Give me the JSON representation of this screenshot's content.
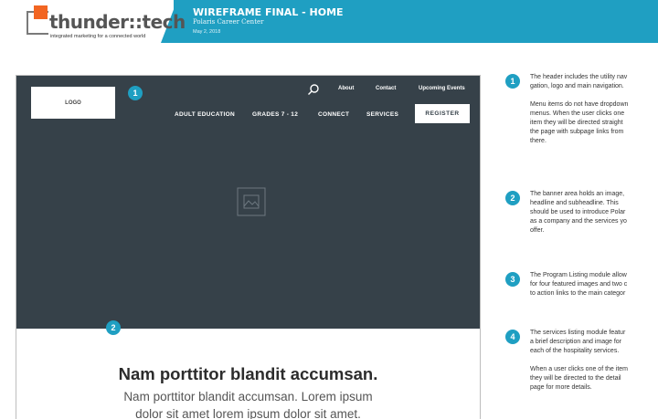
{
  "header": {
    "brand": "thunder::tech",
    "tagline": "integrated marketing for a connected world",
    "doc_title": "WIREFRAME FINAL - HOME",
    "client": "Polaris Career Center",
    "date": "May 2, 2018",
    "accent_color": "#1f9fc2",
    "logo_color": "#f26522"
  },
  "wireframe": {
    "logo_label": "LOGO",
    "utility_nav": [
      "About",
      "Contact",
      "Upcoming Events"
    ],
    "main_nav": [
      "ADULT EDUCATION",
      "GRADES 7 - 12",
      "CONNECT",
      "SERVICES"
    ],
    "register_label": "REGISTER",
    "badges": [
      "1",
      "2"
    ],
    "headline": "Nam porttitor blandit accumsan.",
    "subheadline_line1": "Nam porttitor blandit accumsan. Lorem ipsum",
    "subheadline_line2": "dolor sit amet lorem ipsum dolor sit amet.",
    "hero_color": "#364149"
  },
  "notes": [
    {
      "num": "1",
      "lines": [
        "The header includes the utility nav",
        "gation, logo and main navigation.",
        "",
        "Menu items do not have dropdown",
        "menus. When the user clicks one",
        "item they will be directed straight",
        "the page with subpage links from",
        "there."
      ]
    },
    {
      "num": "2",
      "lines": [
        "The banner area holds an image,",
        "headline and subheadline. This",
        "should be used to introduce Polar",
        "as a company and the services yo",
        "offer."
      ]
    },
    {
      "num": "3",
      "lines": [
        "The Program Listing module allow",
        "for four featured images and two c",
        "to action links to the main categor"
      ]
    },
    {
      "num": "4",
      "lines": [
        "The services listing module featur",
        "a brief description and image for",
        "each of the hospitality services.",
        "",
        "When a user clicks one of the item",
        "they will be directed to the detail",
        "page for more details."
      ]
    }
  ]
}
